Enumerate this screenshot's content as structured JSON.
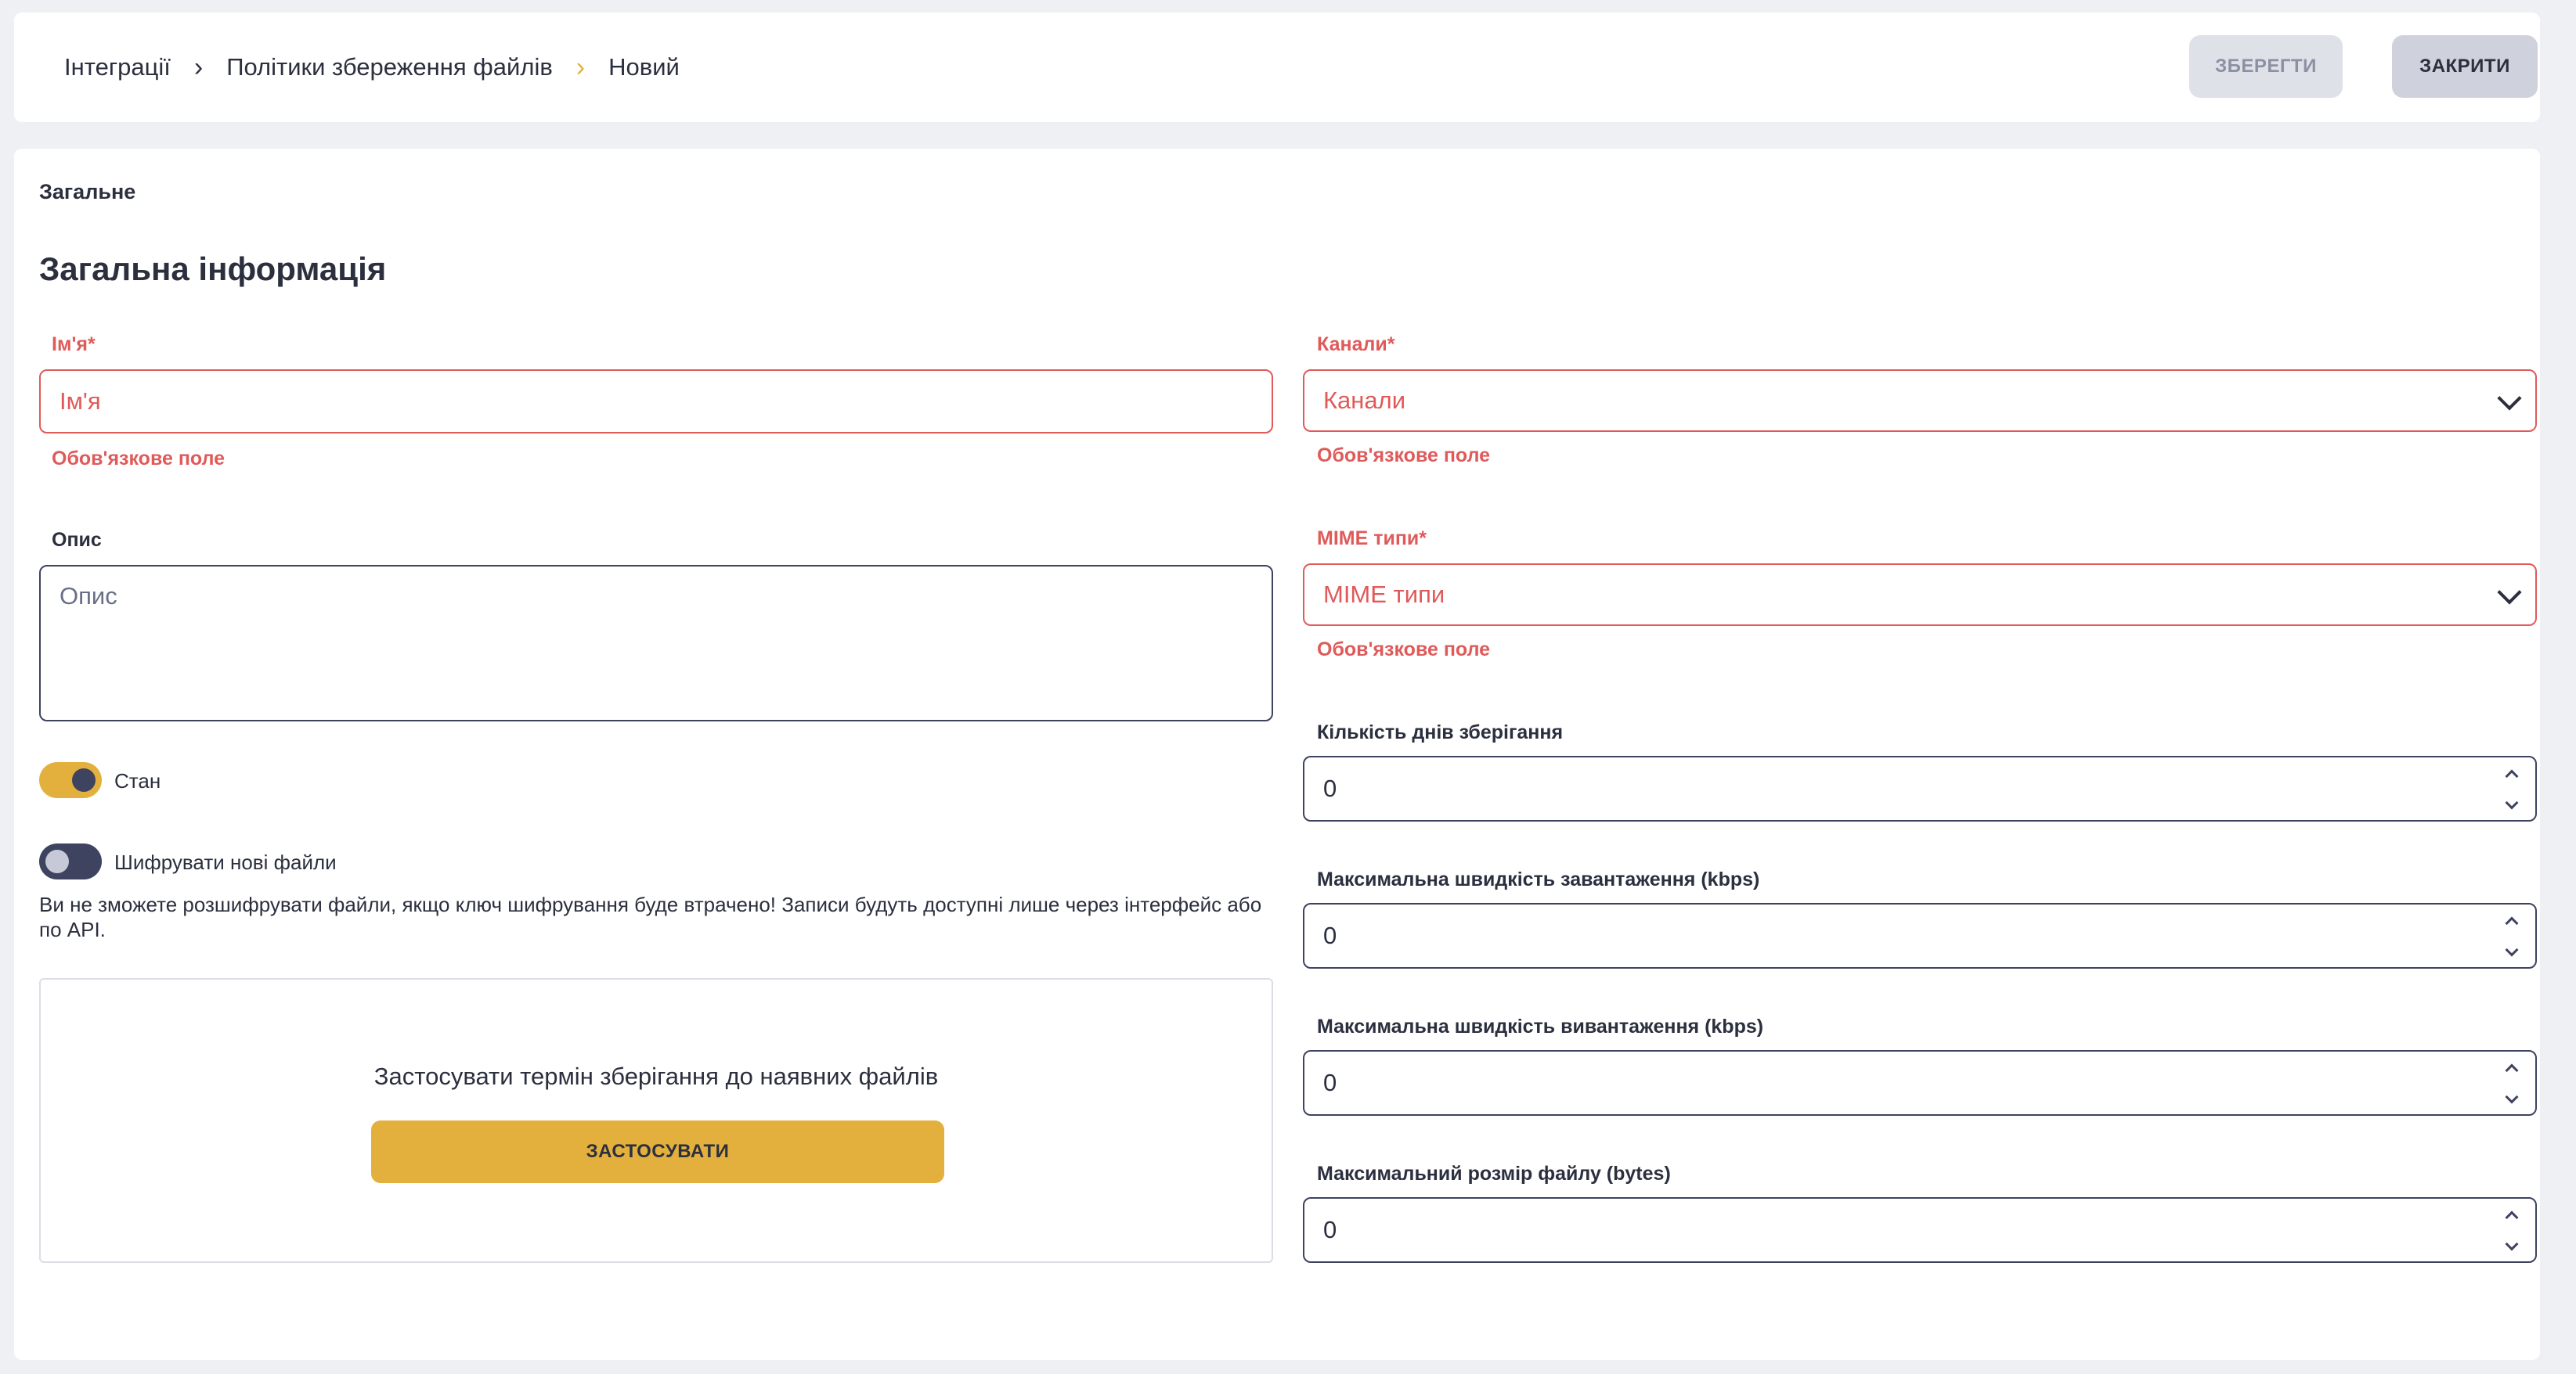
{
  "breadcrumb": {
    "items": [
      "Інтеграції",
      "Політики збереження файлів",
      "Новий"
    ]
  },
  "actions": {
    "save_label": "ЗБЕРЕГТИ",
    "close_label": "ЗАКРИТИ"
  },
  "tab": {
    "label": "Загальне"
  },
  "section": {
    "title": "Загальна інформація"
  },
  "form": {
    "name": {
      "label": "Ім'я*",
      "placeholder": "Ім'я",
      "error": "Обов'язкове поле"
    },
    "description": {
      "label": "Опис",
      "placeholder": "Опис"
    },
    "state": {
      "label": "Стан",
      "on": true
    },
    "encrypt": {
      "label": "Шифрувати нові файли",
      "on": false,
      "warning": "Ви не зможете розшифрувати файли, якщо ключ шифрування буде втрачено! Записи будуть доступні лише через інтерфейс або по API."
    },
    "apply": {
      "text": "Застосувати термін зберігання до наявних файлів",
      "button_label": "ЗАСТОСУВАТИ"
    },
    "channels": {
      "label": "Канали*",
      "placeholder": "Канали",
      "error": "Обов'язкове поле"
    },
    "mime": {
      "label": "MIME типи*",
      "placeholder": "MIME типи",
      "error": "Обов'язкове поле"
    },
    "retention_days": {
      "label": "Кількість днів зберігання",
      "value": "0"
    },
    "max_upload": {
      "label": "Максимальна швидкість завантаження (kbps)",
      "value": "0"
    },
    "max_download": {
      "label": "Максимальна швидкість вивантаження (kbps)",
      "value": "0"
    },
    "max_size": {
      "label": "Максимальний розмір файлу (bytes)",
      "value": "0"
    }
  },
  "colors": {
    "accent": "#e3b03e",
    "error": "#e05a5a",
    "dark": "#3e4360"
  }
}
